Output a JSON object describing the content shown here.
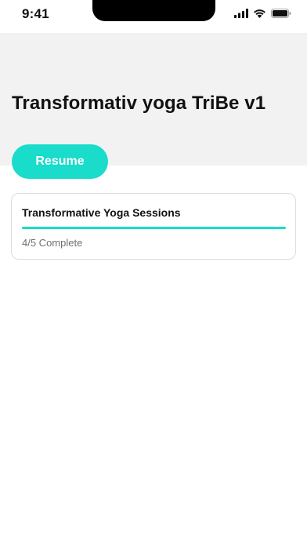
{
  "status_bar": {
    "time": "9:41",
    "icons": [
      "cellular-signal-icon",
      "wifi-icon",
      "battery-icon"
    ]
  },
  "header": {
    "title": "Transformativ yoga TriBe v1"
  },
  "actions": {
    "resume_label": "Resume"
  },
  "course_card": {
    "title": "Transformative Yoga Sessions",
    "progress_text": "4/5 Complete",
    "progress_fraction": 1.0
  },
  "colors": {
    "accent": "#19dccb",
    "header_background": "#f2f2f2",
    "card_border": "#dcdcdc",
    "muted_text": "#707070"
  }
}
